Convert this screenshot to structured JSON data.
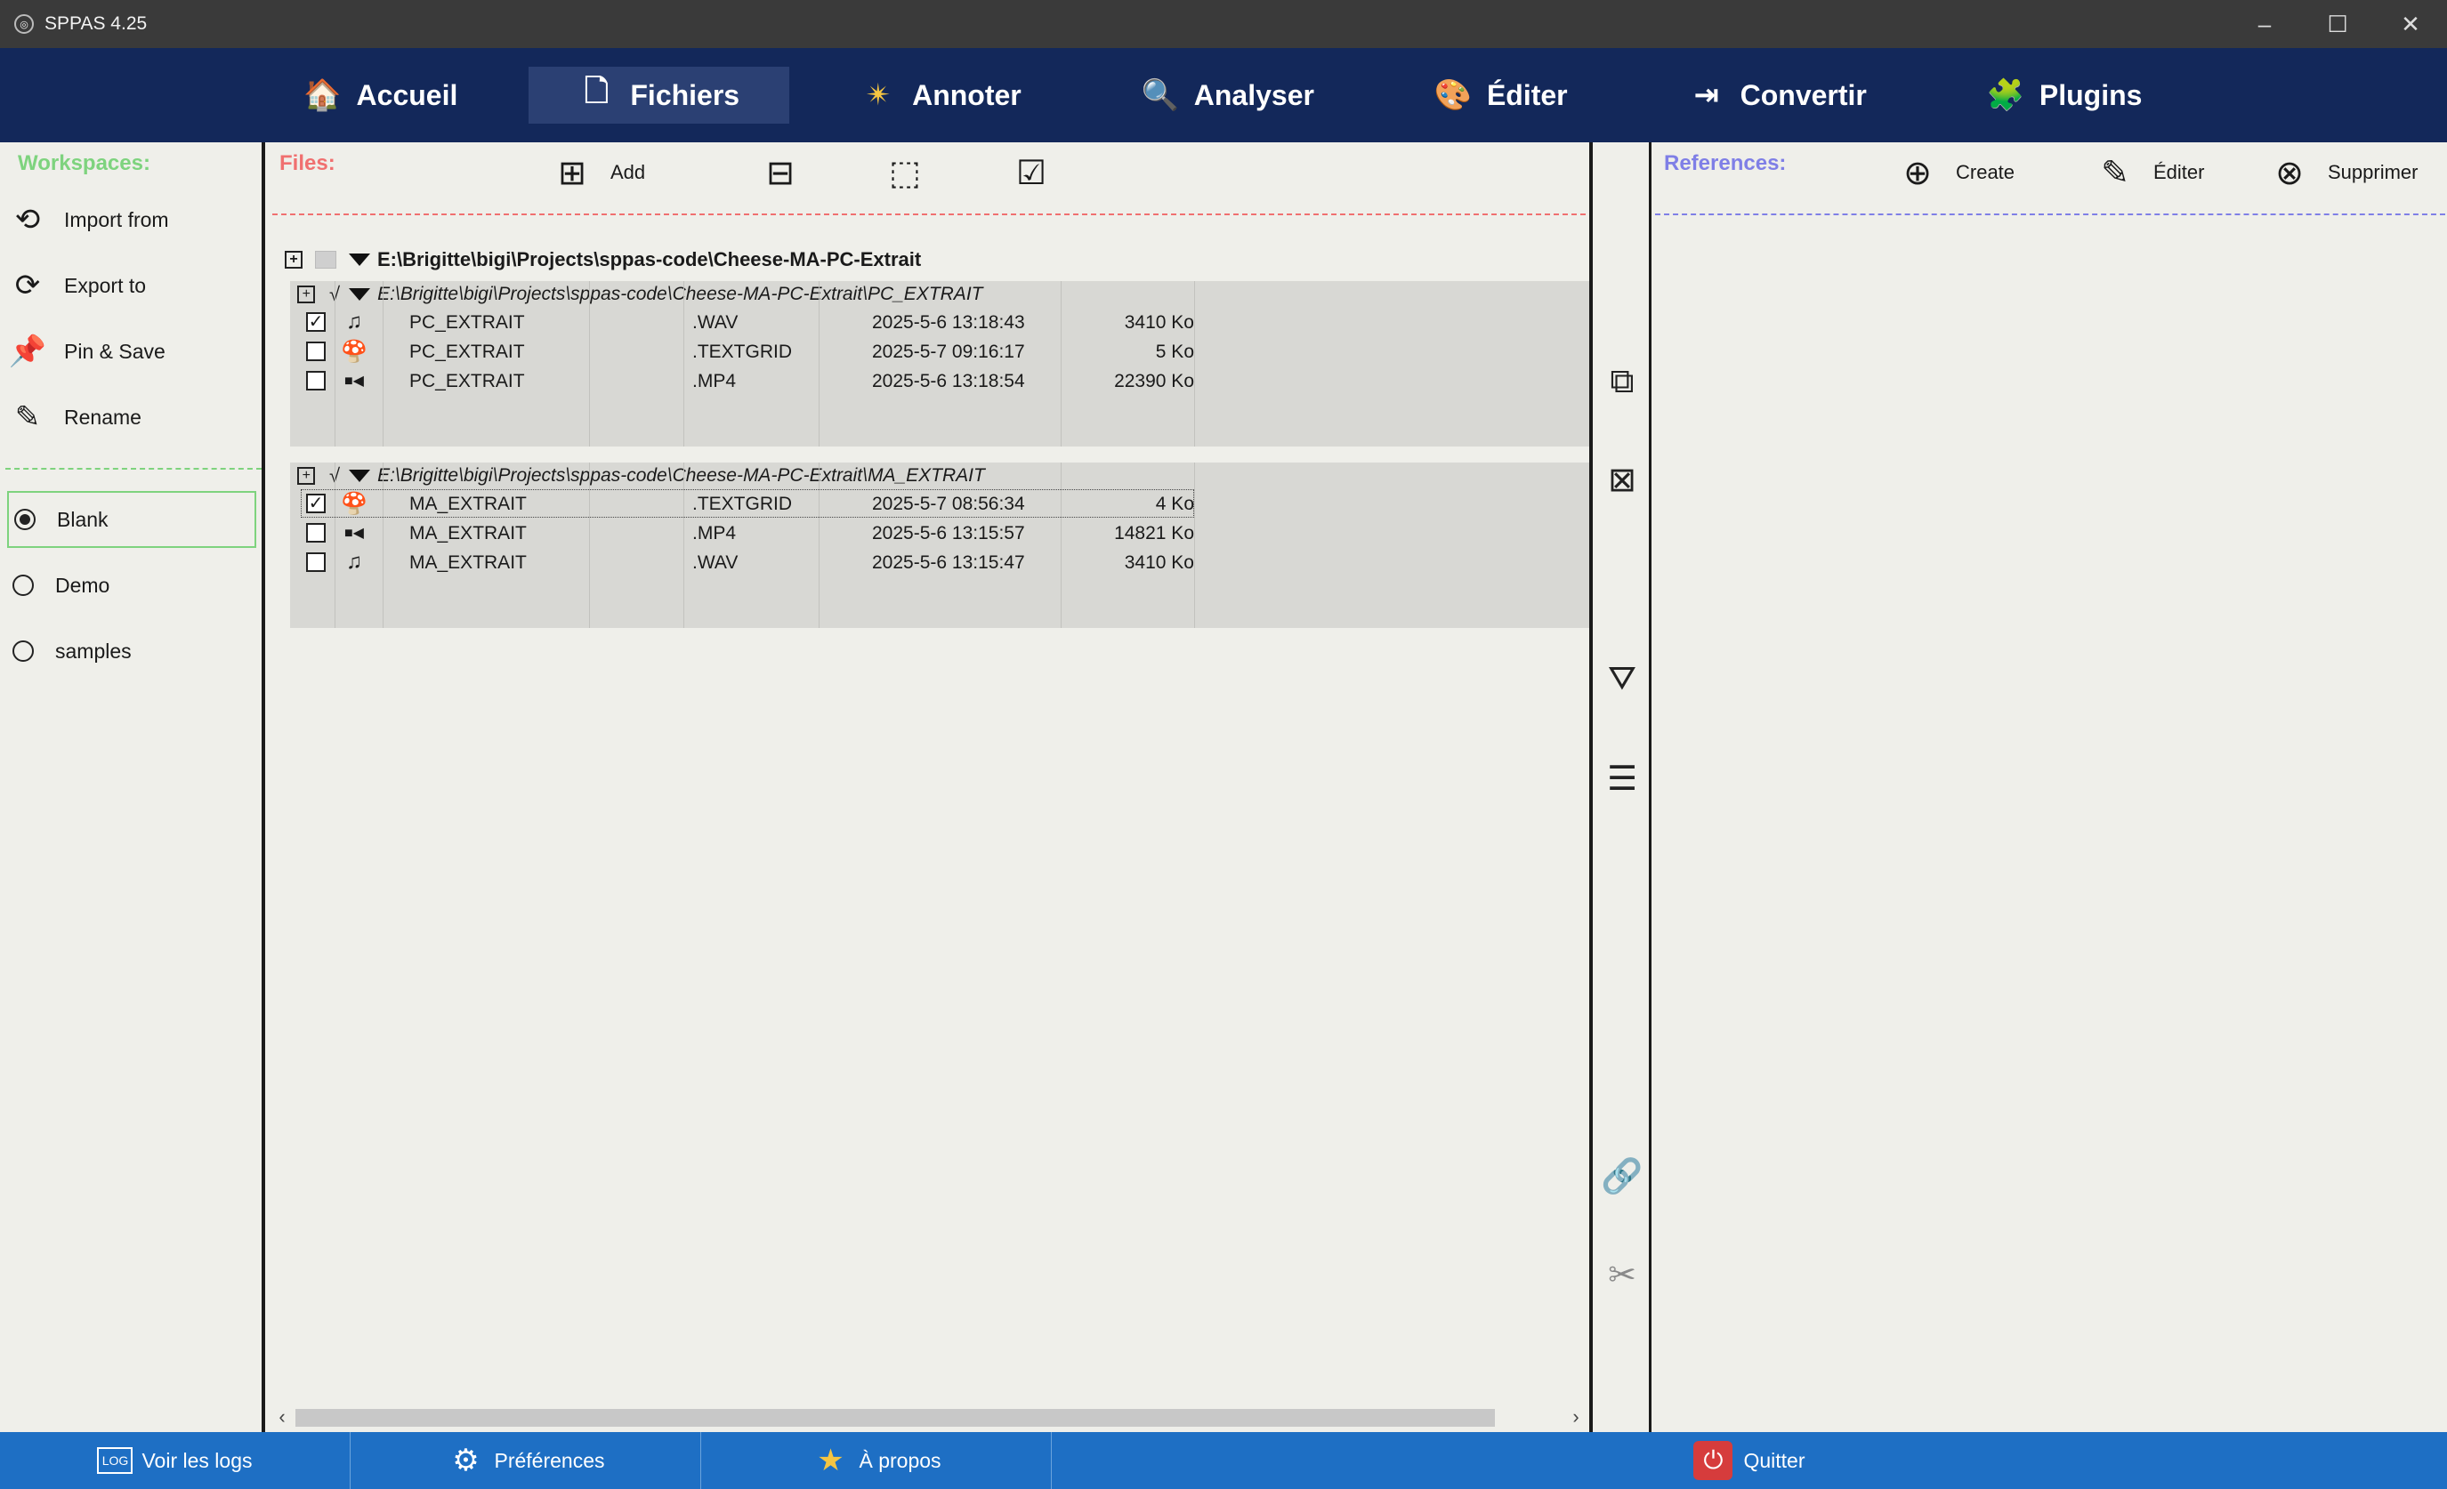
{
  "window": {
    "title": "SPPAS 4.25",
    "minimize": "–",
    "maximize": "☐",
    "close": "✕"
  },
  "menu": {
    "tabs": [
      {
        "label": "Accueil",
        "icon": "🏠"
      },
      {
        "label": "Fichiers",
        "icon": "🗋"
      },
      {
        "label": "Annoter",
        "icon": "✴"
      },
      {
        "label": "Analyser",
        "icon": "🔍"
      },
      {
        "label": "Éditer",
        "icon": "🎨"
      },
      {
        "label": "Convertir",
        "icon": "⇥"
      },
      {
        "label": "Plugins",
        "icon": "🧩"
      }
    ],
    "active": "Fichiers"
  },
  "workspaces": {
    "title": "Workspaces:",
    "actions": [
      {
        "label": "Import from",
        "icon": "⟲"
      },
      {
        "label": "Export to",
        "icon": "⟳"
      },
      {
        "label": "Pin & Save",
        "icon": "📌"
      },
      {
        "label": "Rename",
        "icon": "✎"
      }
    ],
    "items": [
      {
        "label": "Blank",
        "selected": true
      },
      {
        "label": "Demo",
        "selected": false
      },
      {
        "label": "samples",
        "selected": false
      }
    ]
  },
  "files": {
    "title": "Files:",
    "toolbar": {
      "add_label": "Add"
    },
    "root_path": "E:\\Brigitte\\bigi\\Projects\\sppas-code\\Cheese-MA-PC-Extrait",
    "groups": [
      {
        "path": "E:\\Brigitte\\bigi\\Projects\\sppas-code\\Cheese-MA-PC-Extrait\\PC_EXTRAIT",
        "files": [
          {
            "checked": true,
            "icon": "♫",
            "name": "PC_EXTRAIT",
            "ext": ".WAV",
            "date": "2025-5-6 13:18:43",
            "size": "3410 Ko"
          },
          {
            "checked": false,
            "icon": "🍄",
            "name": "PC_EXTRAIT",
            "ext": ".TEXTGRID",
            "date": "2025-5-7 09:16:17",
            "size": "5 Ko"
          },
          {
            "checked": false,
            "icon": "■◀",
            "name": "PC_EXTRAIT",
            "ext": ".MP4",
            "date": "2025-5-6 13:18:54",
            "size": "22390 Ko"
          }
        ]
      },
      {
        "path": "E:\\Brigitte\\bigi\\Projects\\sppas-code\\Cheese-MA-PC-Extrait\\MA_EXTRAIT",
        "files": [
          {
            "checked": true,
            "icon": "🍄",
            "name": "MA_EXTRAIT",
            "ext": ".TEXTGRID",
            "date": "2025-5-7 08:56:34",
            "size": "4 Ko"
          },
          {
            "checked": false,
            "icon": "■◀",
            "name": "MA_EXTRAIT",
            "ext": ".MP4",
            "date": "2025-5-6 13:15:57",
            "size": "14821 Ko"
          },
          {
            "checked": false,
            "icon": "♫",
            "name": "MA_EXTRAIT",
            "ext": ".WAV",
            "date": "2025-5-6 13:15:47",
            "size": "3410 Ko"
          }
        ]
      }
    ]
  },
  "references": {
    "title": "References:",
    "create_label": "Create",
    "edit_label": "Éditer",
    "delete_label": "Supprimer"
  },
  "bottom": {
    "logs_label": "Voir les logs",
    "prefs_label": "Préférences",
    "about_label": "À propos",
    "quit_label": "Quitter"
  },
  "colors": {
    "menubar": "#13285a",
    "bottombar": "#1e6fc4",
    "workspaces_accent": "#7ed37e",
    "files_accent": "#f07070",
    "references_accent": "#7f7fe6"
  }
}
